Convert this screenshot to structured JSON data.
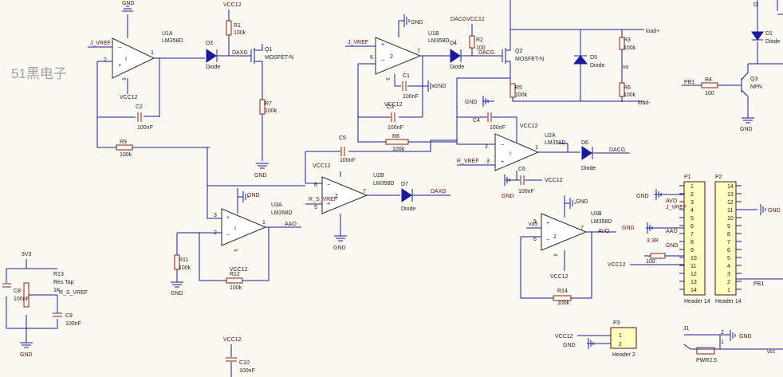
{
  "watermark": "51黑电子",
  "ic": {
    "u1a": {
      "ref": "U1A",
      "part": "LM358D"
    },
    "u1b": {
      "ref": "U1B",
      "part": "LM358D"
    },
    "u2a": {
      "ref": "U2A",
      "part": "LM358D"
    },
    "u2b": {
      "ref": "U2B",
      "part": "LM358D"
    },
    "u3a": {
      "ref": "U3A",
      "part": "LM358D"
    },
    "u3b": {
      "ref": "U3B",
      "part": "LM358D"
    }
  },
  "mosfet": {
    "q1": "Q1",
    "q2": "Q2",
    "type": "MOSFET-N"
  },
  "bjt": {
    "ref": "Q3",
    "type": "NPN"
  },
  "diode": {
    "type": "Diode",
    "d3": "D3",
    "d4": "D4",
    "d5": "D5",
    "d6": "D6",
    "d7": "D7",
    "d1": "D1",
    "d_top": "D"
  },
  "r": {
    "r1": "R1",
    "r2": "R2",
    "r3": "R3",
    "r4": "R4",
    "r5": "R5",
    "r6": "R6",
    "r7": "R7",
    "r8": "R8",
    "r9": "R9",
    "r11": "R11",
    "r12": "R12",
    "r13": "R13",
    "r14": "R14",
    "v100k": "100k",
    "r100": "100",
    "r13_type": "Res Tap",
    "r13_val": "1K"
  },
  "c": {
    "c1": "C1",
    "c2": "C2",
    "c3": "C3",
    "c4": "C4",
    "c5": "C5",
    "c6": "C6",
    "c8": "C8",
    "c9": "C9",
    "c10": "C10",
    "v100nf": "100nF"
  },
  "nets": {
    "gnd": "GND",
    "vcc12": "VCC12",
    "v3v3": "3V3",
    "j_vref": "J_VREF",
    "r_vref": "R_VREF",
    "rs_vref": "R_S_VREF",
    "daxg": "DAXG",
    "dacg": "DACG",
    "daxg_out": "DAXG",
    "dacg_out": "DACG",
    "dacg_vcc": "DACGVCC12",
    "aao": "AAO",
    "avo": "AVO",
    "load_p": "load+",
    "load_m": "load-",
    "vo": "vo",
    "vo5": "vo5",
    "pb1": "PB1",
    "vo_r": "vo",
    "sr": "3.3R",
    "va": "vcc"
  },
  "pins": {
    "p1": "1",
    "p2": "2",
    "p3": "3",
    "p5": "5",
    "p6": "6",
    "p7": "7",
    "p8": "8",
    "p4": "4",
    "p14": "14"
  },
  "headers": {
    "p1": "P1",
    "p2": "P2",
    "p3": "P3",
    "j1": "J1",
    "h14": "Header 14",
    "h2": "Header 2",
    "pwr": "PWR2.5",
    "pins14": [
      "1",
      "2",
      "3",
      "4",
      "5",
      "6",
      "7",
      "8",
      "9",
      "10",
      "11",
      "12",
      "13",
      "14"
    ],
    "pins14r": [
      "14",
      "13",
      "12",
      "11",
      "10",
      "9",
      "8",
      "7",
      "6",
      "5",
      "4",
      "3",
      "2",
      "1"
    ],
    "p1_labels": [
      "AVO",
      "J_VREF",
      "AAO",
      "GND",
      "VCC12"
    ]
  },
  "colors": {
    "wire": "#1a1a9a",
    "part": "#8a1e1e",
    "paper": "#fbf9f0"
  }
}
